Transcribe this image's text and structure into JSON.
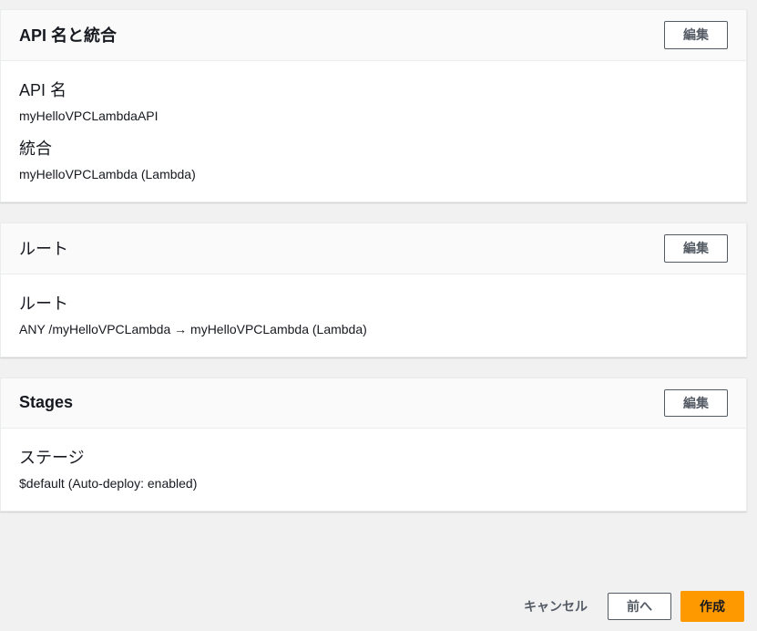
{
  "panels": {
    "apiName": {
      "title": "API 名と統合",
      "editLabel": "編集",
      "fields": {
        "name": {
          "label": "API 名",
          "value": "myHelloVPCLambdaAPI"
        },
        "integration": {
          "label": "統合",
          "value": "myHelloVPCLambda (Lambda)"
        }
      }
    },
    "routes": {
      "title": "ルート",
      "editLabel": "編集",
      "fields": {
        "route": {
          "label": "ルート",
          "value": "ANY /myHelloVPCLambda → myHelloVPCLambda (Lambda)"
        }
      }
    },
    "stages": {
      "title": "Stages",
      "editLabel": "編集",
      "fields": {
        "stage": {
          "label": "ステージ",
          "value": "$default (Auto-deploy: enabled)"
        }
      }
    }
  },
  "footer": {
    "cancel": "キャンセル",
    "previous": "前へ",
    "create": "作成"
  }
}
